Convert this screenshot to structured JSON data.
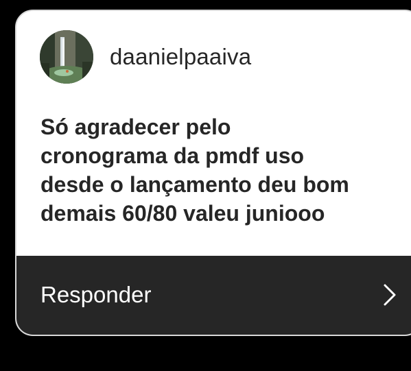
{
  "notification": {
    "username": "daanielpaaiva",
    "message": "Só agradecer pelo\ncronograma da pmdf uso\ndesde o lançamento deu bom\ndemais 60/80 valeu juniooo",
    "reply_label": "Responder"
  },
  "icons": {
    "avatar": "profile-photo-waterfall",
    "reply_arrow": "chevron-right-icon"
  },
  "colors": {
    "background": "#000000",
    "card": "#ffffff",
    "text": "#262626",
    "reply_bar": "#262626",
    "reply_text": "#ffffff"
  }
}
